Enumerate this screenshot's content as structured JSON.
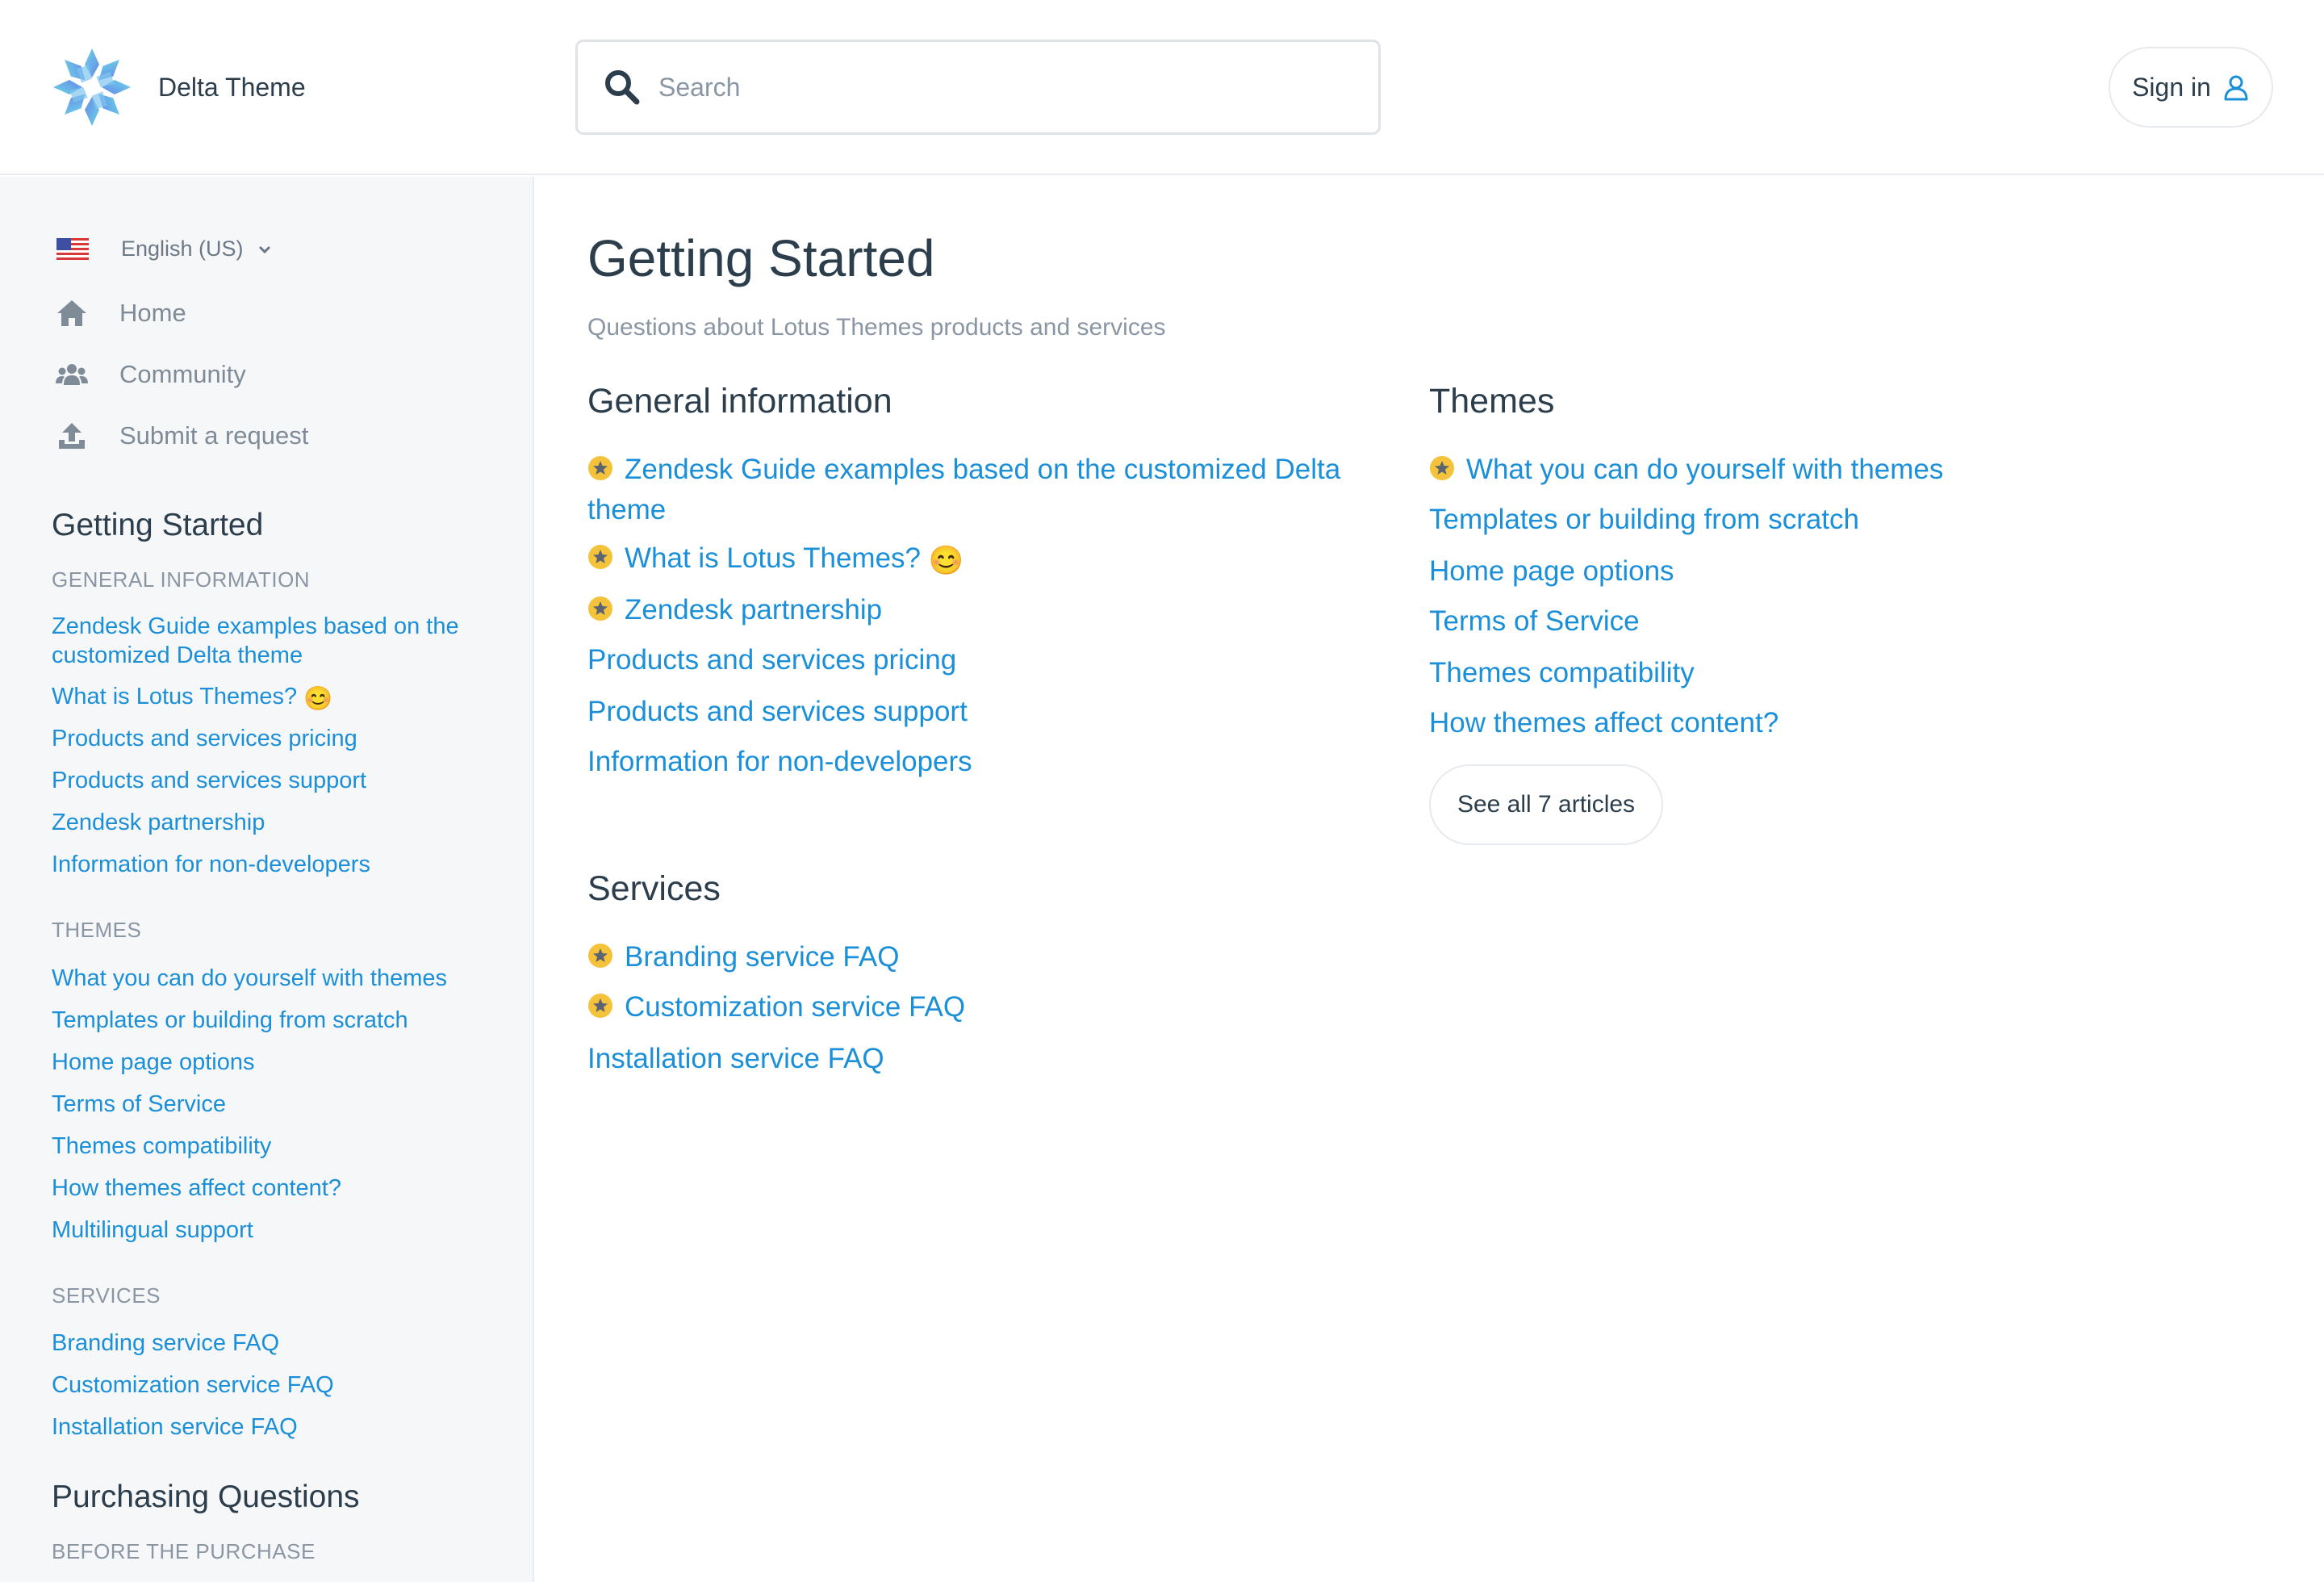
{
  "brand": {
    "name": "Delta Theme"
  },
  "search": {
    "placeholder": "Search"
  },
  "header": {
    "signin_label": "Sign in"
  },
  "colors": {
    "link": "#1b8fd8",
    "text": "#2c3e4c",
    "muted": "#8a96a3",
    "star": "#f5c33b"
  },
  "sidebar": {
    "language": "English (US)",
    "nav": [
      {
        "label": "Home",
        "icon": "home-icon"
      },
      {
        "label": "Community",
        "icon": "community-icon"
      },
      {
        "label": "Submit a request",
        "icon": "upload-icon"
      }
    ],
    "sections": [
      {
        "title": "Getting Started",
        "categories": [
          {
            "name": "GENERAL INFORMATION",
            "links": [
              "Zendesk Guide examples based on the customized Delta theme",
              "What is Lotus Themes?",
              "Products and services pricing",
              "Products and services support",
              "Zendesk partnership",
              "Information for non-developers"
            ]
          },
          {
            "name": "THEMES",
            "links": [
              "What you can do yourself with themes",
              "Templates or building from scratch",
              "Home page options",
              "Terms of Service",
              "Themes compatibility",
              "How themes affect content?",
              "Multilingual support"
            ]
          },
          {
            "name": "SERVICES",
            "links": [
              "Branding service FAQ",
              "Customization service FAQ",
              "Installation service FAQ"
            ]
          }
        ]
      },
      {
        "title": "Purchasing Questions",
        "categories": [
          {
            "name": "BEFORE THE PURCHASE",
            "links": []
          }
        ]
      }
    ]
  },
  "main": {
    "title": "Getting Started",
    "subtitle": "Questions about Lotus Themes products and services",
    "sections": [
      {
        "title": "General information",
        "articles": [
          {
            "label": "Zendesk Guide examples based on the customized Delta theme",
            "promoted": true
          },
          {
            "label": "What is Lotus Themes?",
            "promoted": true,
            "emoji": "😊"
          },
          {
            "label": "Zendesk partnership",
            "promoted": true
          },
          {
            "label": "Products and services pricing",
            "promoted": false
          },
          {
            "label": "Products and services support",
            "promoted": false
          },
          {
            "label": "Information for non-developers",
            "promoted": false
          }
        ]
      },
      {
        "title": "Themes",
        "articles": [
          {
            "label": "What you can do yourself with themes",
            "promoted": true
          },
          {
            "label": "Templates or building from scratch",
            "promoted": false
          },
          {
            "label": "Home page options",
            "promoted": false
          },
          {
            "label": "Terms of Service",
            "promoted": false
          },
          {
            "label": "Themes compatibility",
            "promoted": false
          },
          {
            "label": "How themes affect content?",
            "promoted": false
          }
        ],
        "see_all_label": "See all 7 articles"
      },
      {
        "title": "Services",
        "articles": [
          {
            "label": "Branding service FAQ",
            "promoted": true
          },
          {
            "label": "Customization service FAQ",
            "promoted": true
          },
          {
            "label": "Installation service FAQ",
            "promoted": false
          }
        ]
      }
    ]
  }
}
